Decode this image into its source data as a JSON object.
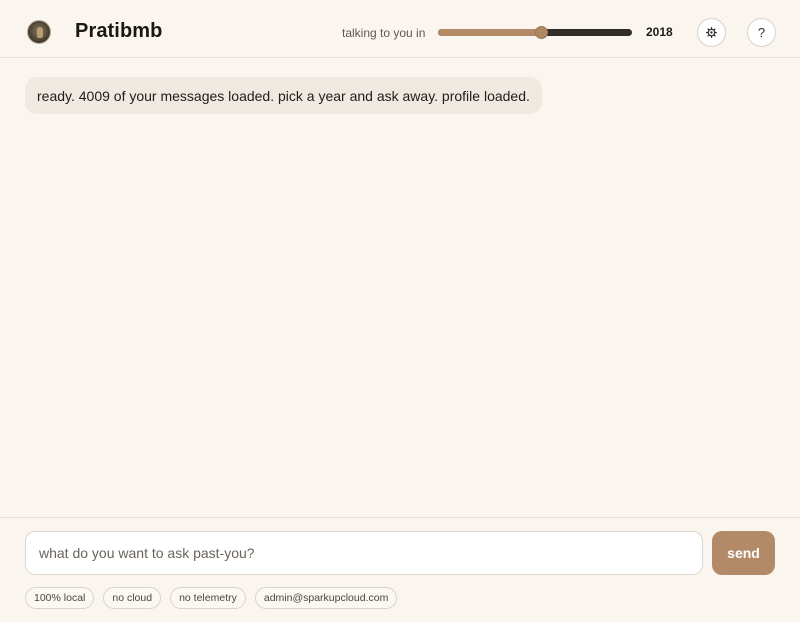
{
  "app": {
    "title": "Pratibmb"
  },
  "header": {
    "year_label": "talking to you in",
    "year_value": "2018",
    "slider_fraction": 0.53,
    "settings_icon": "gear-icon",
    "help_label": "?"
  },
  "messages": [
    {
      "role": "assistant",
      "text": "ready. 4009 of your messages loaded. pick a year and ask away. profile loaded."
    }
  ],
  "composer": {
    "placeholder": "what do you want to ask past-you?",
    "value": "",
    "send_label": "send"
  },
  "badges": [
    "100% local",
    "no cloud",
    "no telemetry",
    "admin@sparkupcloud.com"
  ],
  "colors": {
    "background": "#faf6ef",
    "accent": "#b38a68",
    "bubble": "#efe9e1",
    "slider_track": "#2f2c29"
  }
}
